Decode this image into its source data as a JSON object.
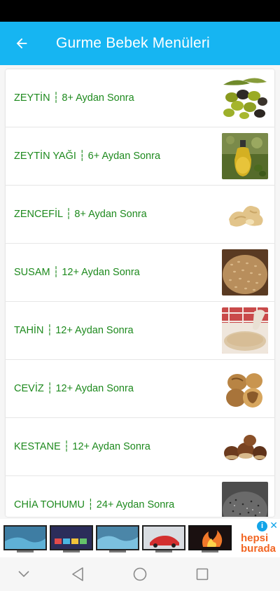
{
  "app_bar": {
    "title": "Gurme Bebek Menüleri",
    "color": "#16b5f2",
    "back_icon": "arrow-left-icon"
  },
  "list": {
    "label_color": "#1e8a1e",
    "items": [
      {
        "label": "ZEYTİN ┆ 8+ Aydan Sonra",
        "image": "olives"
      },
      {
        "label": "ZEYTİN YAĞI ┆ 6+ Aydan Sonra",
        "image": "olive-oil"
      },
      {
        "label": "ZENCEFİL ┆ 8+ Aydan Sonra",
        "image": "ginger"
      },
      {
        "label": "SUSAM ┆ 12+ Aydan Sonra",
        "image": "sesame"
      },
      {
        "label": "TAHİN ┆ 12+ Aydan Sonra",
        "image": "tahini"
      },
      {
        "label": "CEVİZ ┆ 12+ Aydan Sonra",
        "image": "walnut"
      },
      {
        "label": "KESTANE ┆ 12+ Aydan Sonra",
        "image": "chestnut"
      },
      {
        "label": "CHİA TOHUMU ┆ 24+ Aydan Sonra",
        "image": "chia-seeds"
      }
    ]
  },
  "ad": {
    "brand_line1": "hepsi",
    "brand_line2": "burada",
    "brand_color": "#f26522",
    "info_icon": "info-icon",
    "close_icon": "close-icon",
    "tiles": [
      "tv-ocean",
      "tv-apps",
      "tv-ocean",
      "tv-car",
      "tv-fire"
    ]
  },
  "nav_bar": {
    "icons": [
      "chevron-down-icon",
      "back-triangle-icon",
      "home-circle-icon",
      "recents-square-icon"
    ]
  }
}
